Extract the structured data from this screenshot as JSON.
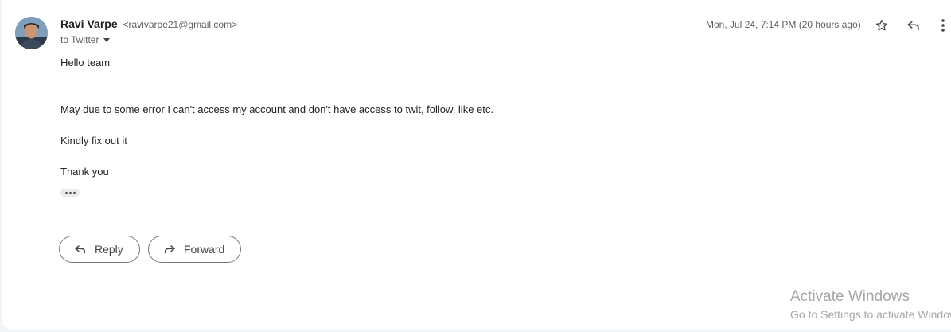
{
  "message": {
    "sender_name": "Ravi Varpe",
    "sender_email": "<ravivarpe21@gmail.com>",
    "recipient_line": "to Twitter",
    "date": "Mon, Jul 24, 7:14 PM (20 hours ago)",
    "body": {
      "greeting": "Hello team",
      "paragraph_1": "May due to some error I can't access my account and don't have access to twit, follow, like etc.",
      "paragraph_2": "Kindly fix out it",
      "closing": "Thank you"
    }
  },
  "actions": {
    "reply_label": "Reply",
    "forward_label": "Forward"
  },
  "icons": {
    "star": "star-icon",
    "reply": "reply-icon",
    "more": "more-vert-icon",
    "expand": "ellipsis-icon",
    "forward": "forward-icon"
  },
  "watermark": {
    "title": "Activate Windows",
    "subtitle": "Go to Settings to activate Windows."
  }
}
